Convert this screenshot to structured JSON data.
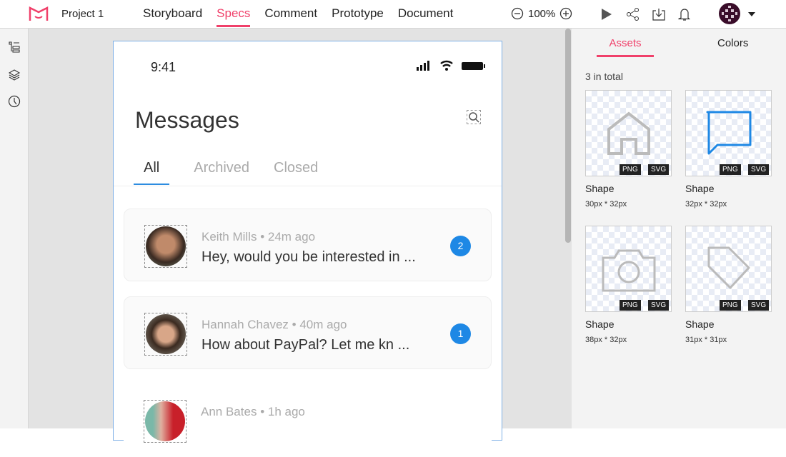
{
  "header": {
    "project": "Project 1",
    "nav": [
      "Storyboard",
      "Specs",
      "Comment",
      "Prototype",
      "Document"
    ],
    "active": "Specs",
    "zoom": "100%"
  },
  "phone": {
    "time": "9:41",
    "title": "Messages",
    "tabs": [
      "All",
      "Archived",
      "Closed"
    ],
    "messages": [
      {
        "name": "Keith Mills",
        "time": "• 24m ago",
        "text": "Hey, would you be interested in ...",
        "badge": "2"
      },
      {
        "name": "Hannah Chavez",
        "time": "• 40m ago",
        "text": "How about PayPal? Let me kn ...",
        "badge": "1"
      },
      {
        "name": "Ann Bates",
        "time": "• 1h ago"
      }
    ]
  },
  "panel": {
    "tabs": [
      "Assets",
      "Colors"
    ],
    "total": "3 in total",
    "assets": [
      {
        "icon": "home-icon",
        "name": "Shape",
        "size": "30px * 32px",
        "formats": [
          "PNG",
          "SVG"
        ]
      },
      {
        "icon": "chat-bubble-icon",
        "name": "Shape",
        "size": "32px * 32px",
        "formats": [
          "PNG",
          "SVG"
        ]
      },
      {
        "icon": "camera-icon",
        "name": "Shape",
        "size": "38px * 32px",
        "formats": [
          "PNG",
          "SVG"
        ]
      },
      {
        "icon": "tag-icon",
        "name": "Shape",
        "size": "31px * 31px",
        "formats": [
          "PNG",
          "SVG"
        ]
      }
    ]
  },
  "colors": {
    "accent": "#f0406a",
    "blue": "#1e88e5"
  }
}
